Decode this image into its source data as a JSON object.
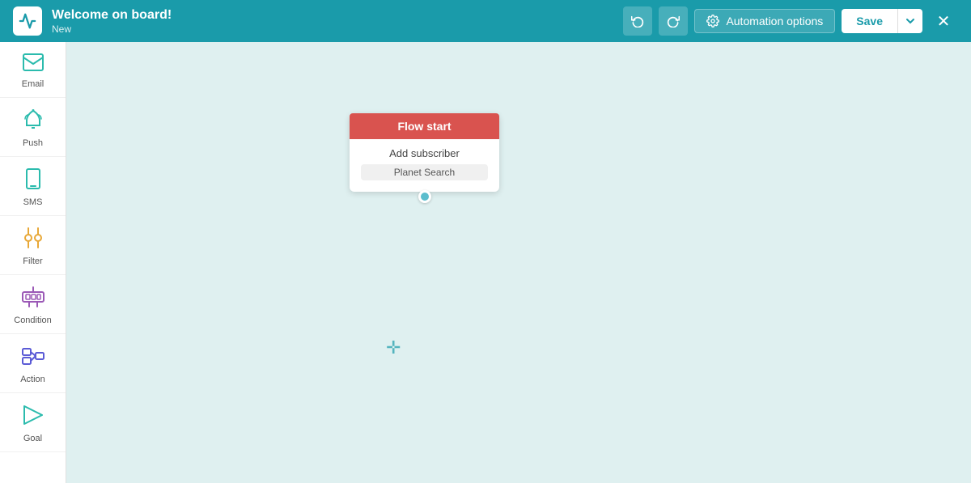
{
  "header": {
    "logo_alt": "app-logo",
    "title": "Welcome on board!",
    "subtitle": "New",
    "undo_label": "↺",
    "redo_label": "↻",
    "automation_options_label": "Automation options",
    "save_label": "Save",
    "save_dropdown_label": "▾",
    "close_label": "✕"
  },
  "sidebar": {
    "items": [
      {
        "id": "email",
        "label": "Email",
        "icon": "✉"
      },
      {
        "id": "push",
        "label": "Push",
        "icon": "🔔"
      },
      {
        "id": "sms",
        "label": "SMS",
        "icon": "📱"
      },
      {
        "id": "filter",
        "label": "Filter",
        "icon": "⑂"
      },
      {
        "id": "condition",
        "label": "Condition",
        "icon": "🤖"
      },
      {
        "id": "action",
        "label": "Action",
        "icon": "⇄"
      },
      {
        "id": "goal",
        "label": "Goal",
        "icon": "⚑"
      }
    ]
  },
  "canvas": {
    "flow_node": {
      "header": "Flow start",
      "trigger": "Add subscriber",
      "source": "Planet Search"
    }
  }
}
